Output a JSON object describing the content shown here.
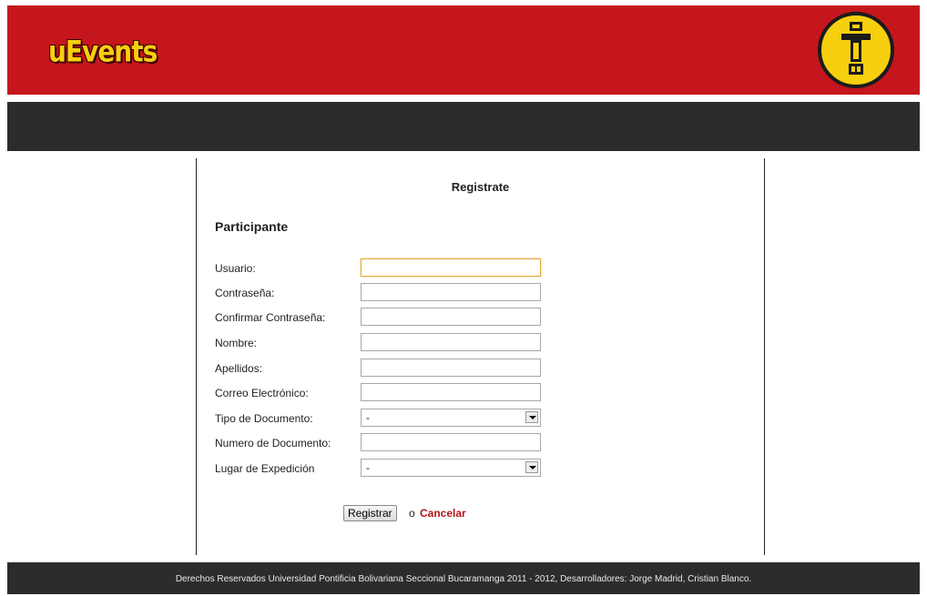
{
  "header": {
    "logo": "uEvents",
    "emblem_icon": "university-emblem-icon"
  },
  "form": {
    "title": "Registrate",
    "section": "Participante",
    "fields": [
      {
        "label": "Usuario:",
        "type": "text",
        "value": ""
      },
      {
        "label": "Contraseña:",
        "type": "password",
        "value": ""
      },
      {
        "label": "Confirmar Contraseña:",
        "type": "password",
        "value": ""
      },
      {
        "label": "Nombre:",
        "type": "text",
        "value": ""
      },
      {
        "label": "Apellidos:",
        "type": "text",
        "value": ""
      },
      {
        "label": "Correo Electrónico:",
        "type": "text",
        "value": ""
      },
      {
        "label": "Tipo de Documento:",
        "type": "select",
        "value": "-"
      },
      {
        "label": "Numero de Documento:",
        "type": "text",
        "value": ""
      },
      {
        "label": "Lugar de Expedición",
        "type": "select",
        "value": "-"
      }
    ],
    "submit_label": "Registrar",
    "or_text": "o",
    "cancel_label": "Cancelar"
  },
  "footer": {
    "text": "Derechos Reservados Universidad Pontificia Bolivariana Seccional Bucaramanga 2011 - 2012, Desarrolladores: Jorge Madrid, Cristian Blanco."
  },
  "colors": {
    "header": "#c5161d",
    "bars": "#2c2c2c",
    "logo": "#f6cf0e",
    "link": "#b0151a"
  }
}
